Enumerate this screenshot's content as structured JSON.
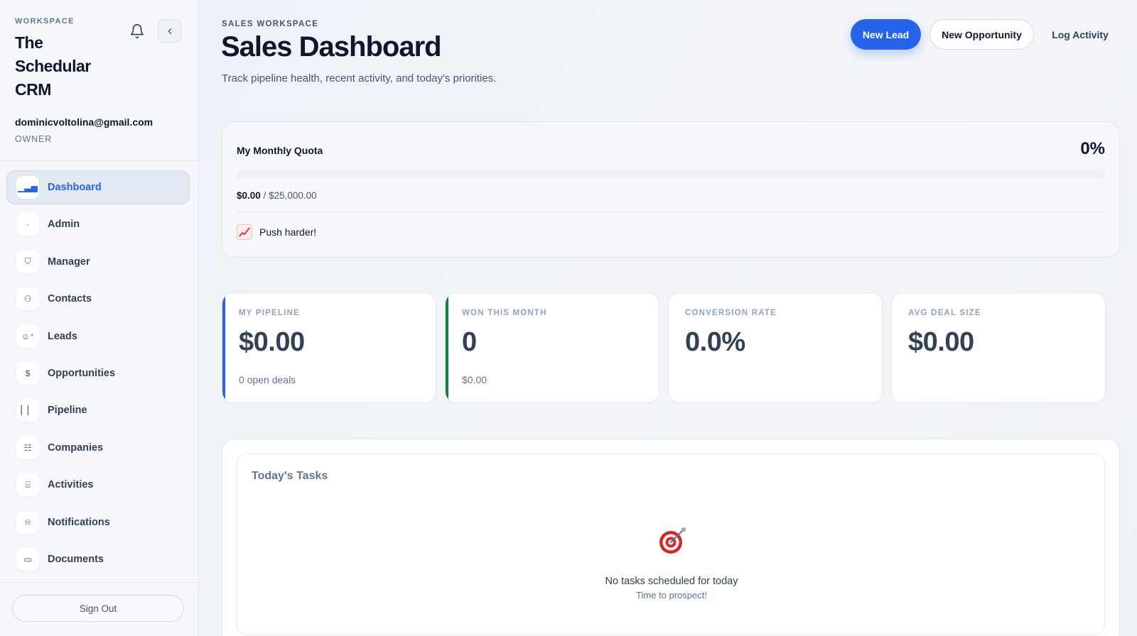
{
  "sidebar": {
    "workspace_label": "WORKSPACE",
    "workspace_name": "The Schedular CRM",
    "user_email": "dominicvoltolina@gmail.com",
    "user_role": "OWNER",
    "items": [
      {
        "label": "Dashboard",
        "icon": "bar-chart-icon",
        "glyph": "▁▃▅",
        "active": true
      },
      {
        "label": "Admin",
        "icon": "dot-icon",
        "glyph": "·"
      },
      {
        "label": "Manager",
        "icon": "shield-icon",
        "glyph": "⛉"
      },
      {
        "label": "Contacts",
        "icon": "users-icon",
        "glyph": "⚇"
      },
      {
        "label": "Leads",
        "icon": "user-plus-icon",
        "glyph": "☺⁺"
      },
      {
        "label": "Opportunities",
        "icon": "dollar-icon",
        "glyph": "$"
      },
      {
        "label": "Pipeline",
        "icon": "columns-icon",
        "glyph": "▏▏"
      },
      {
        "label": "Companies",
        "icon": "building-icon",
        "glyph": "☷"
      },
      {
        "label": "Activities",
        "icon": "clipboard-icon",
        "glyph": "⌸"
      },
      {
        "label": "Notifications",
        "icon": "bell-icon",
        "glyph": "⍾"
      },
      {
        "label": "Documents",
        "icon": "folder-icon",
        "glyph": "▭"
      }
    ],
    "sign_out": "Sign Out"
  },
  "header": {
    "eyebrow": "SALES WORKSPACE",
    "title": "Sales Dashboard",
    "subtitle": "Track pipeline health, recent activity, and today's priorities.",
    "actions": {
      "new_lead": "New Lead",
      "new_opportunity": "New Opportunity",
      "log_activity": "Log Activity"
    }
  },
  "quota": {
    "title": "My Monthly Quota",
    "percent_label": "0%",
    "progress_fraction": 0,
    "current": "$0.00",
    "separator": " / ",
    "target": "$25,000.00",
    "message": "Push harder!",
    "message_icon": "chart-increasing-icon"
  },
  "stats": [
    {
      "label": "MY PIPELINE",
      "value": "$0.00",
      "sub": "0 open deals",
      "accent": "#2563eb"
    },
    {
      "label": "WON THIS MONTH",
      "value": "0",
      "sub": "$0.00",
      "accent": "#15803d"
    },
    {
      "label": "CONVERSION RATE",
      "value": "0.0%",
      "sub": "",
      "accent": ""
    },
    {
      "label": "AVG DEAL SIZE",
      "value": "$0.00",
      "sub": "",
      "accent": ""
    }
  ],
  "tasks": {
    "title": "Today's Tasks",
    "empty_icon": "target-icon",
    "empty_text": "No tasks scheduled for today",
    "empty_sub": "Time to prospect!"
  },
  "colors": {
    "primary": "#2563eb",
    "success": "#15803d",
    "text": "#0f172a",
    "muted": "#64748b"
  }
}
